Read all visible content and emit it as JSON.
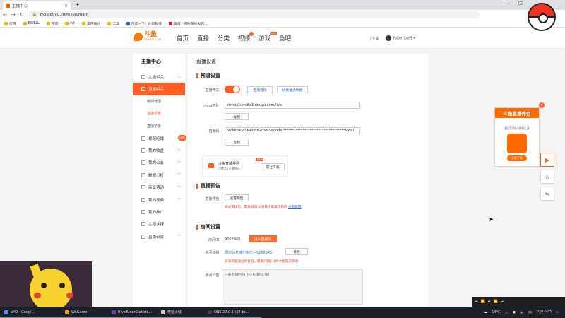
{
  "browser": {
    "tab_title": "主播中心",
    "url": "mp.douyu.com/live/main",
    "bookmarks": [
      "应用",
      "EWELL",
      "网志",
      "tvt",
      "常用搜台",
      "工具",
      "百度一下，你就知道",
      "微博 - 随时随地发现..."
    ]
  },
  "site": {
    "logo_text": "斗鱼",
    "logo_sub": "DOUYU.COM",
    "nav": [
      "首页",
      "直播",
      "分类",
      "视频",
      "游戏",
      "鱼吧"
    ],
    "game_badge": "NEW",
    "download_label": "下载",
    "username": "Pokemon仔"
  },
  "sidebar": {
    "title": "主播中心",
    "items": [
      {
        "label": "主播相关"
      },
      {
        "label": "直播相关"
      },
      {
        "label": "视频轮播"
      },
      {
        "label": "我的收益"
      },
      {
        "label": "我的公会"
      },
      {
        "label": "数据分析"
      },
      {
        "label": "商业活动"
      },
      {
        "label": "我的视频"
      },
      {
        "label": "我的推广"
      },
      {
        "label": "主播扶持"
      },
      {
        "label": "直播带货"
      }
    ],
    "sub_items": [
      "房间管理",
      "直播设置",
      "直播记录"
    ],
    "trial_badge": "试听"
  },
  "main": {
    "page_title": "直播设置",
    "push": {
      "title": "推流设置",
      "switch_label": "直播开关:",
      "tutorial_btn": "直播教程",
      "switch_line_btn": "切换推流线路",
      "rtmp_label": "rtmp地址:",
      "rtmp_value": "rtmp://sendtc3.douyu.com/live",
      "copy_btn": "复制",
      "code_label": "直播码:",
      "code_value": "9268845rSMe0BtGt?wsSecret=***********************************&wsTi",
      "copy_btn2": "复制"
    },
    "promo": {
      "name": "斗鱼直播伴侣",
      "sub": "已覆盖1万播房间",
      "new_badge": "NEW",
      "download_btn": "前往下载"
    },
    "preview": {
      "title": "直播预告",
      "label": "直播预告:",
      "set_btn": "设置预告",
      "warn": "通过审核后，需要间隔10分钟才能再次修改",
      "rule_link": "查看说明"
    },
    "room": {
      "title": "房间设置",
      "id_label": "房间ID:",
      "id_value": "9268845",
      "enter_btn": "进入直播间",
      "name_label": "房间标题:",
      "name_value": "周末休息吸乐用已～9268845",
      "edit_btn": "修改",
      "name_warn": "房间标题通过审核后，需要间隔1分钟才能再次修改",
      "notice_label": "房间公告:",
      "notice_value": "一般直播时间 下午6:30-0:00"
    }
  },
  "ad": {
    "title": "斗鱼直播伴侣",
    "desc": "最好用的PC直播工具",
    "download": "立即下载"
  },
  "taskbar": {
    "tasks": [
      "ePO - Googl...",
      "WeGame",
      "RivaTunerStatisti...",
      "穿越火线",
      "OBS 27.0.1 (64-bi..."
    ],
    "temp": "14°C",
    "ime": "中",
    "date": "2021/12/5"
  }
}
